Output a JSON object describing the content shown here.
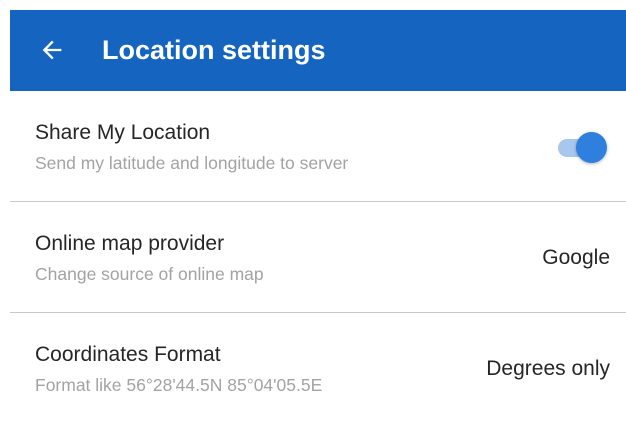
{
  "app_bar": {
    "title": "Location settings",
    "back_icon": "arrow-left-icon",
    "background": "#1565c0"
  },
  "settings": [
    {
      "title": "Share My Location",
      "summary": "Send my latitude and longitude to server",
      "toggle_on": true
    },
    {
      "title": "Online map provider",
      "summary": "Change source of online map",
      "value": "Google"
    },
    {
      "title": "Coordinates Format",
      "summary": "Format like 56°28'44.5N 85°04'05.5E",
      "value": "Degrees only"
    }
  ],
  "colors": {
    "accent": "#2f80de",
    "toggle_track": "#a8c7ec",
    "title_text": "#262626",
    "summary_text": "#a3a3a3"
  }
}
